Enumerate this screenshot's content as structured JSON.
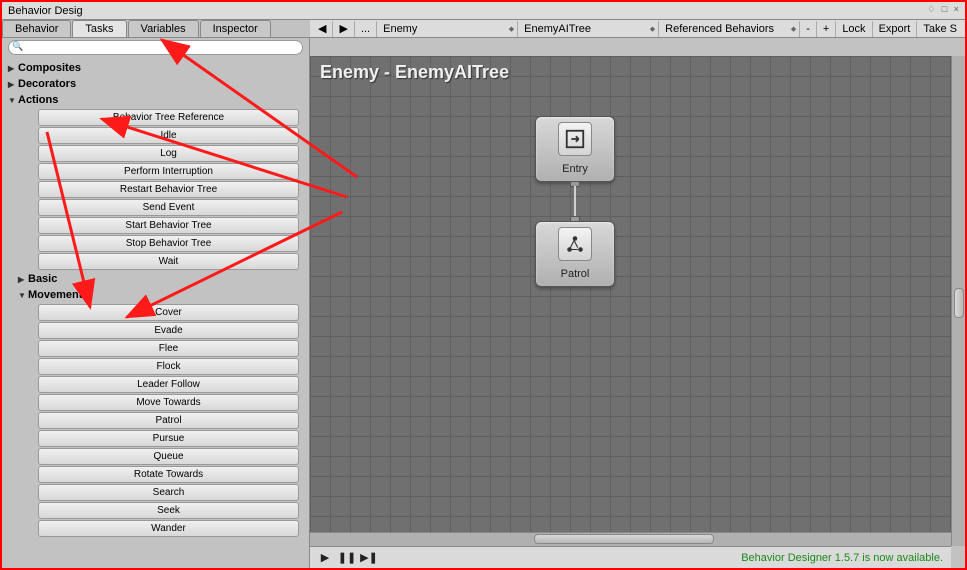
{
  "window": {
    "title": "Behavior Desig",
    "controls": "♢ □ ×"
  },
  "tabs": {
    "behavior": "Behavior",
    "tasks": "Tasks",
    "variables": "Variables",
    "inspector": "Inspector"
  },
  "toolbar": {
    "prev": "◀",
    "next": "▶",
    "more": "...",
    "target": "Enemy",
    "tree": "EnemyAITree",
    "ref": "Referenced Behaviors",
    "minus": "-",
    "plus": "+",
    "lock": "Lock",
    "export": "Export",
    "take": "Take S"
  },
  "tree": {
    "composites": "Composites",
    "decorators": "Decorators",
    "actions": {
      "label": "Actions",
      "items": [
        "Behavior Tree Reference",
        "Idle",
        "Log",
        "Perform Interruption",
        "Restart Behavior Tree",
        "Send Event",
        "Start Behavior Tree",
        "Stop Behavior Tree",
        "Wait"
      ],
      "basic": "Basic",
      "movement": {
        "label": "Movement",
        "items": [
          "Cover",
          "Evade",
          "Flee",
          "Flock",
          "Leader Follow",
          "Move Towards",
          "Patrol",
          "Pursue",
          "Queue",
          "Rotate Towards",
          "Search",
          "Seek",
          "Wander"
        ]
      }
    }
  },
  "canvas": {
    "title": "Enemy - EnemyAITree",
    "node_entry": "Entry",
    "node_patrol": "Patrol"
  },
  "status": "Behavior Designer 1.5.7 is now available."
}
